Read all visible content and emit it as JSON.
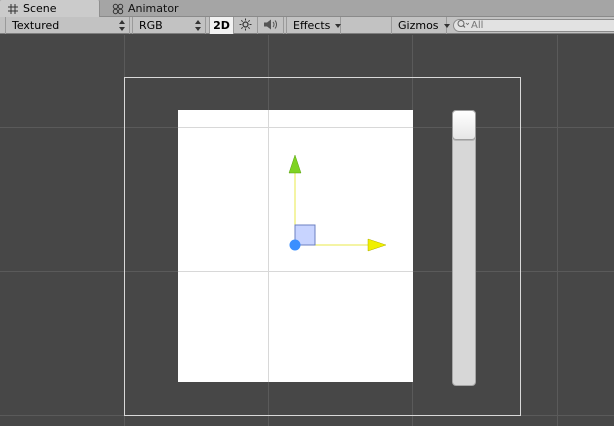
{
  "tabs": [
    {
      "label": "Scene",
      "icon": "scene-grid-icon",
      "active": true
    },
    {
      "label": "Animator",
      "icon": "animator-icon",
      "active": false
    }
  ],
  "toolbar": {
    "render_mode": "Textured",
    "color_mode": "RGB",
    "mode_2d": "2D",
    "lighting_icon": "sun-icon",
    "audio_icon": "speaker-icon",
    "effects_label": "Effects",
    "gizmos_label": "Gizmos",
    "search_placeholder": "All",
    "search_icon": "search-icon"
  },
  "scene": {
    "background_color": "#474747",
    "panel_color": "#ffffff",
    "x_axis_color": "#ffff00",
    "y_axis_color": "#7ed321",
    "pivot_color": "#3a8fff",
    "rect_handle_color": "#c8d4ff"
  }
}
